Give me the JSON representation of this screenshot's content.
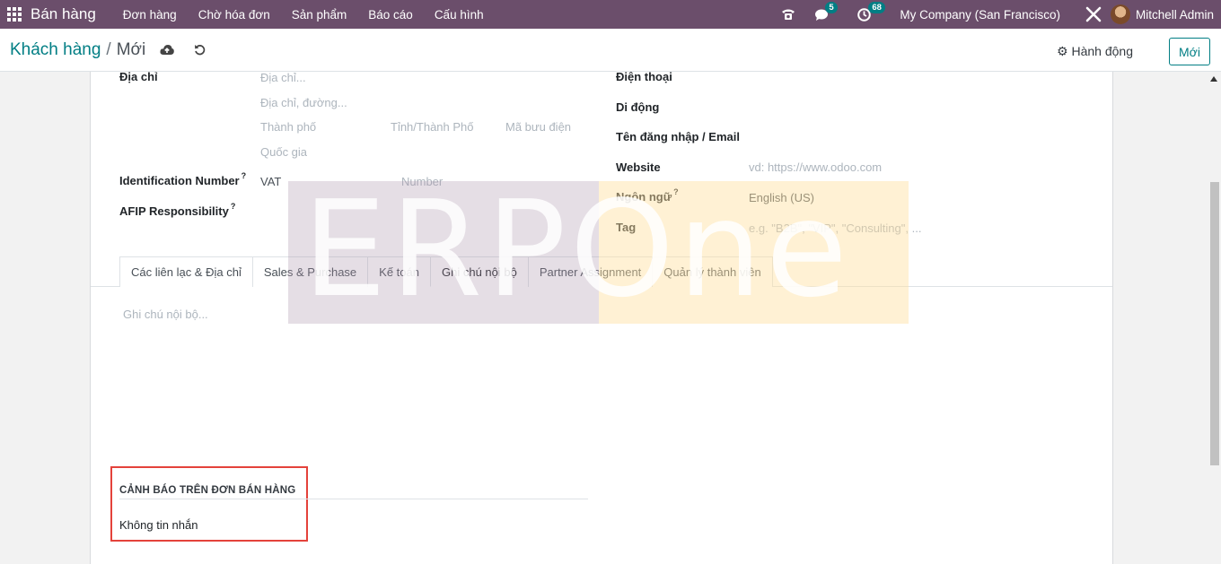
{
  "navbar": {
    "brand": "Bán hàng",
    "menu": [
      "Đơn hàng",
      "Chờ hóa đơn",
      "Sản phẩm",
      "Báo cáo",
      "Cấu hình"
    ],
    "messages_count": "5",
    "activities_count": "68",
    "company": "My Company (San Francisco)",
    "user": "Mitchell Admin"
  },
  "control": {
    "breadcrumb_parent": "Khách hàng",
    "breadcrumb_sep": "/",
    "breadcrumb_current": "Mới",
    "actions_label": "Hành động",
    "new_label": "Mới"
  },
  "form": {
    "address_label": "Địa chỉ",
    "address_placeholder": "Địa chỉ...",
    "street2_placeholder": "Địa chỉ, đường...",
    "city_placeholder": "Thành phố",
    "state_placeholder": "Tỉnh/Thành Phố",
    "zip_placeholder": "Mã bưu điện",
    "country_placeholder": "Quốc gia",
    "ident_label": "Identification Number",
    "ident_type": "VAT",
    "ident_number_placeholder": "Number",
    "afip_label": "AFIP Responsibility",
    "help_mark": "?",
    "phone_label": "Điện thoại",
    "mobile_label": "Di động",
    "login_label": "Tên đăng nhập / Email",
    "website_label": "Website",
    "website_placeholder": "vd: https://www.odoo.com",
    "lang_label": "Ngôn ngữ",
    "lang_value": "English (US)",
    "tag_label": "Tag",
    "tag_placeholder": "e.g. \"B2B\", \"VIP\", \"Consulting\", ..."
  },
  "tabs": [
    "Các liên lạc & Địa chỉ",
    "Sales & Purchase",
    "Kế toán",
    "Ghi chú nội bộ",
    "Partner Assignment",
    "Quản lý thành viên"
  ],
  "notes_placeholder": "Ghi chú nội bộ...",
  "warning": {
    "title": "CẢNH BÁO TRÊN ĐƠN BÁN HÀNG",
    "value": "Không tin nhắn"
  },
  "watermark": "ERPOne",
  "icons": [
    "apps-grid-icon",
    "phone-icon",
    "chat-icon",
    "clock-icon",
    "tools-icon",
    "cloud-upload-icon",
    "undo-icon",
    "gear-icon"
  ],
  "colors": {
    "navbar": "#6b4e6b",
    "accent": "#017e84",
    "highlight": "#e4423b"
  }
}
